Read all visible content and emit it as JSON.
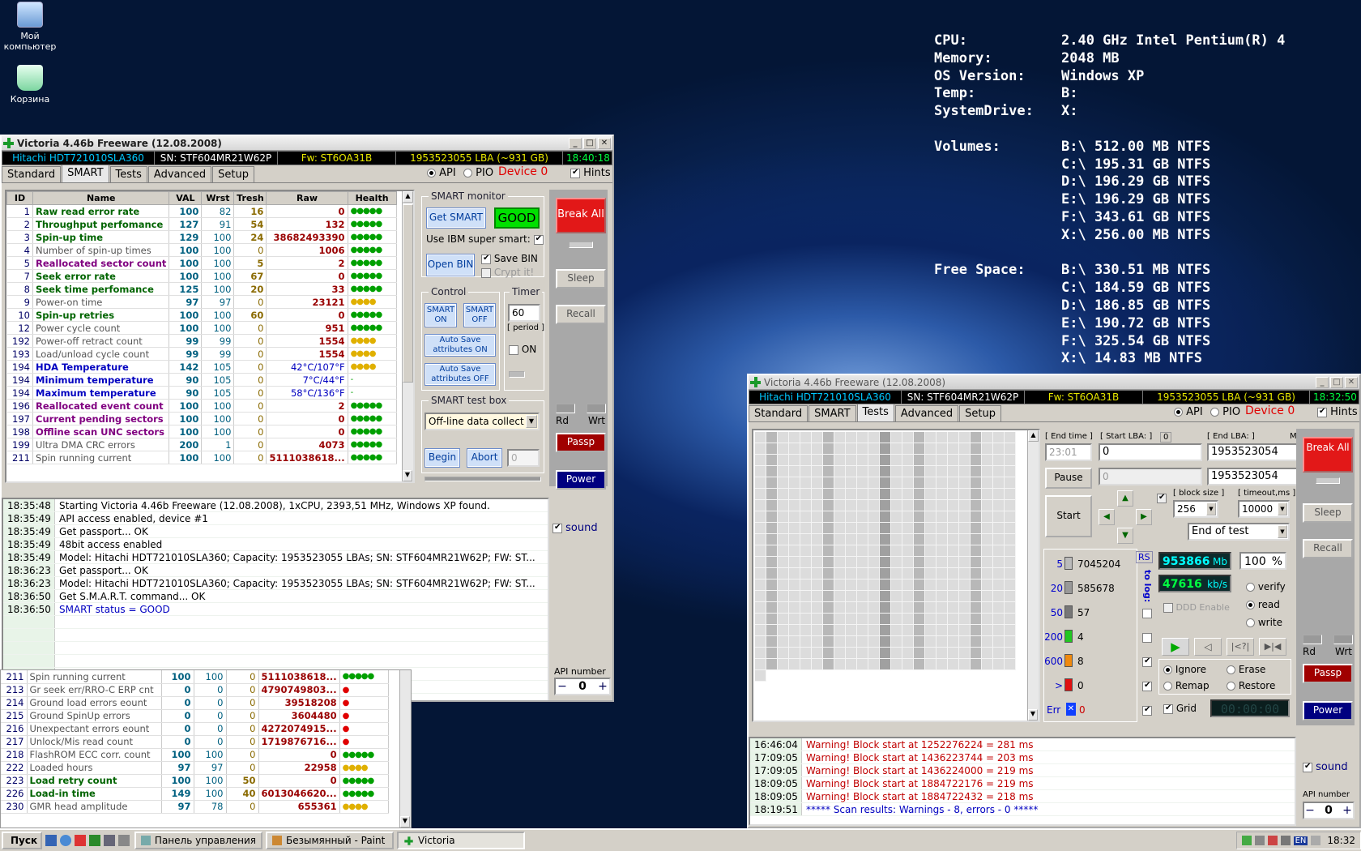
{
  "desktop": {
    "icons": [
      {
        "label": "Мой компьютер"
      },
      {
        "label": "Корзина"
      }
    ]
  },
  "bginfo": {
    "rows": [
      [
        "CPU:",
        "2.40 GHz Intel Pentium(R) 4"
      ],
      [
        "Memory:",
        "2048 MB"
      ],
      [
        "OS Version:",
        "Windows XP"
      ],
      [
        "Temp:",
        "B:"
      ],
      [
        "SystemDrive:",
        "X:"
      ]
    ],
    "volumes_label": "Volumes:",
    "volumes": [
      "B:\\ 512.00 MB NTFS",
      "C:\\ 195.31 GB NTFS",
      "D:\\ 196.29 GB NTFS",
      "E:\\ 196.29 GB NTFS",
      "F:\\ 343.61 GB NTFS",
      "X:\\ 256.00 MB NTFS"
    ],
    "free_label": "Free Space:",
    "free": [
      "B:\\ 330.51 MB NTFS",
      "C:\\ 184.59 GB NTFS",
      "D:\\ 186.85 GB NTFS",
      "E:\\ 190.72 GB NTFS",
      "F:\\ 325.54 GB NTFS",
      "X:\\ 14.83 MB NTFS"
    ]
  },
  "win1": {
    "title": "Victoria 4.46b Freeware (12.08.2008)",
    "model": "Hitachi HDT721010SLA360",
    "sn": "SN: STF604MR21W62P",
    "fw": "Fw: ST6OA31B",
    "lba": "1953523055 LBA (~931 GB)",
    "clock": "18:40:18",
    "tabs": [
      "Standard",
      "SMART",
      "Tests",
      "Advanced",
      "Setup"
    ],
    "api": "API",
    "pio": "PIO",
    "device": "Device 0",
    "hints": "Hints",
    "columns": [
      "ID",
      "Name",
      "VAL",
      "Wrst",
      "Tresh",
      "Raw",
      "Health"
    ],
    "rows": [
      [
        "1",
        "Raw read error rate",
        "100",
        "82",
        "16",
        "0",
        "●●●●●",
        "g"
      ],
      [
        "2",
        "Throughput perfomance",
        "127",
        "91",
        "54",
        "132",
        "●●●●●",
        "g"
      ],
      [
        "3",
        "Spin-up time",
        "129",
        "100",
        "24",
        "38682493390",
        "●●●●●",
        "g"
      ],
      [
        "4",
        "Number of spin-up times",
        "100",
        "100",
        "0",
        "1006",
        "●●●●●",
        "n"
      ],
      [
        "5",
        "Reallocated sector count",
        "100",
        "100",
        "5",
        "2",
        "●●●●●",
        "p"
      ],
      [
        "7",
        "Seek error rate",
        "100",
        "100",
        "67",
        "0",
        "●●●●●",
        "g"
      ],
      [
        "8",
        "Seek time perfomance",
        "125",
        "100",
        "20",
        "33",
        "●●●●●",
        "g"
      ],
      [
        "9",
        "Power-on time",
        "97",
        "97",
        "0",
        "23121",
        "●●●●",
        "n"
      ],
      [
        "10",
        "Spin-up retries",
        "100",
        "100",
        "60",
        "0",
        "●●●●●",
        "g"
      ],
      [
        "12",
        "Power cycle count",
        "100",
        "100",
        "0",
        "951",
        "●●●●●",
        "n"
      ],
      [
        "192",
        "Power-off retract count",
        "99",
        "99",
        "0",
        "1554",
        "●●●●",
        "n"
      ],
      [
        "193",
        "Load/unload cycle count",
        "99",
        "99",
        "0",
        "1554",
        "●●●●",
        "n"
      ],
      [
        "194",
        "HDA Temperature",
        "142",
        "105",
        "0",
        "42°C/107°F",
        "●●●●",
        "b"
      ],
      [
        "194",
        "Minimum temperature",
        "90",
        "105",
        "0",
        "7°C/44°F",
        "-",
        "b"
      ],
      [
        "194",
        "Maximum temperature",
        "90",
        "105",
        "0",
        "58°C/136°F",
        "-",
        "b"
      ],
      [
        "196",
        "Reallocated event count",
        "100",
        "100",
        "0",
        "2",
        "●●●●●",
        "p"
      ],
      [
        "197",
        "Current pending sectors",
        "100",
        "100",
        "0",
        "0",
        "●●●●●",
        "p"
      ],
      [
        "198",
        "Offline scan UNC sectors",
        "100",
        "100",
        "0",
        "0",
        "●●●●●",
        "p"
      ],
      [
        "199",
        "Ultra DMA CRC errors",
        "200",
        "1",
        "0",
        "4073",
        "●●●●●",
        "n"
      ],
      [
        "211",
        "Spin running current",
        "100",
        "100",
        "0",
        "5111038618...",
        "●●●●●",
        "n"
      ]
    ],
    "smart_monitor": "SMART monitor",
    "get_smart": "Get SMART",
    "status": "GOOD",
    "ibm": "Use IBM super smart:",
    "open_bin": "Open BIN",
    "save_bin": "Save BIN",
    "crypt": "Crypt it!",
    "control": "Control",
    "timer": "Timer",
    "smart_on": "SMART ON",
    "smart_off": "SMART OFF",
    "timer_val": "60",
    "period": "[ period ]",
    "auto_on": "Auto Save attributes ON",
    "auto_off": "Auto Save attributes OFF",
    "on": "ON",
    "testbox": "SMART test box",
    "test_sel": "Off-line data collect",
    "begin": "Begin",
    "abort": "Abort",
    "abort_val": "0",
    "break_all": "Break All",
    "sleep": "Sleep",
    "recall": "Recall",
    "rd": "Rd",
    "wrt": "Wrt",
    "passp": "Passp",
    "power": "Power",
    "sound": "sound",
    "api_number": "API number",
    "api_val": "0",
    "log": [
      [
        "18:35:48",
        "Starting Victoria 4.46b Freeware (12.08.2008), 1xCPU, 2393,51 MHz, Windows XP found."
      ],
      [
        "18:35:49",
        "API access enabled, device #1"
      ],
      [
        "18:35:49",
        "Get passport... OK"
      ],
      [
        "18:35:49",
        "48bit access enabled"
      ],
      [
        "18:35:49",
        "Model: Hitachi HDT721010SLA360; Capacity: 1953523055 LBAs; SN: STF604MR21W62P; FW: ST..."
      ],
      [
        "18:36:23",
        "Get passport... OK"
      ],
      [
        "18:36:23",
        "Model: Hitachi HDT721010SLA360; Capacity: 1953523055 LBAs; SN: STF604MR21W62P; FW: ST..."
      ],
      [
        "18:36:50",
        "Get S.M.A.R.T. command... OK"
      ],
      [
        "18:36:50",
        "SMART status = GOOD"
      ]
    ]
  },
  "extra_rows": [
    [
      "211",
      "Spin running current",
      "100",
      "100",
      "0",
      "5111038618...",
      "●●●●●",
      "n"
    ],
    [
      "213",
      "Gr seek err/RRO-C ERP cnt",
      "0",
      "0",
      "0",
      "4790749803...",
      "●",
      "n"
    ],
    [
      "214",
      "Ground load errors eount",
      "0",
      "0",
      "0",
      "39518208",
      "●",
      "n"
    ],
    [
      "215",
      "Ground SpinUp errors",
      "0",
      "0",
      "0",
      "3604480",
      "●",
      "n"
    ],
    [
      "216",
      "Unexpectant errors eount",
      "0",
      "0",
      "0",
      "4272074915...",
      "●",
      "n"
    ],
    [
      "217",
      "Unlock/Mis read count",
      "0",
      "0",
      "0",
      "1719876716...",
      "●",
      "n"
    ],
    [
      "218",
      "FlashROM ECC corr. count",
      "100",
      "100",
      "0",
      "0",
      "●●●●●",
      "n"
    ],
    [
      "222",
      "Loaded hours",
      "97",
      "97",
      "0",
      "22958",
      "●●●●",
      "n"
    ],
    [
      "223",
      "Load retry count",
      "100",
      "100",
      "50",
      "0",
      "●●●●●",
      "g"
    ],
    [
      "226",
      "Load-in time",
      "149",
      "100",
      "40",
      "6013046620...",
      "●●●●●",
      "g"
    ],
    [
      "230",
      "GMR head amplitude",
      "97",
      "78",
      "0",
      "655361",
      "●●●●",
      "n"
    ]
  ],
  "win2": {
    "title": "Victoria 4.46b Freeware (12.08.2008)",
    "model": "Hitachi HDT721010SLA360",
    "sn": "SN: STF604MR21W62P",
    "fw": "Fw: ST6OA31B",
    "lba": "1953523055 LBA (~931 GB)",
    "clock": "18:32:50",
    "tabs": [
      "Standard",
      "SMART",
      "Tests",
      "Advanced",
      "Setup"
    ],
    "api": "API",
    "pio": "PIO",
    "device": "Device 0",
    "hints": "Hints",
    "end_time_lbl": "[ End time ]",
    "end_time": "23:01",
    "start_lba_lbl": "[ Start LBA: ]",
    "start_lba_zero": "0",
    "end_lba_lbl": "[ End LBA: ]",
    "max": "MAX",
    "start_lba": "0",
    "end_lba": "1953523054",
    "cur_lba": "0",
    "cur_end": "1953523054",
    "pause": "Pause",
    "start": "Start",
    "block_lbl": "[ block size ]",
    "block": "256",
    "timeout_lbl": "[ timeout,ms ]",
    "timeout": "10000",
    "end_mode": "End of test",
    "rs": "RS",
    "tolog": "to log:",
    "counts": [
      [
        "5",
        "7045204",
        "#bbbbbb"
      ],
      [
        "20",
        "585678",
        "#999999"
      ],
      [
        "50",
        "57",
        "#777777"
      ],
      [
        "200",
        "4",
        "#22c722"
      ],
      [
        "600",
        "8",
        "#f08a10"
      ],
      [
        ">",
        "0",
        "#e01010"
      ]
    ],
    "err_label": "Err",
    "err_val": "0",
    "mb": "953866",
    "mb_unit": "Mb",
    "pct": "100",
    "pct_unit": "%",
    "speed": "47616",
    "speed_unit": "kb/s",
    "verify": "verify",
    "read": "read",
    "write": "write",
    "ddd": "DDD Enable",
    "ignore": "Ignore",
    "erase": "Erase",
    "remap": "Remap",
    "restore": "Restore",
    "grid": "Grid",
    "timer": "00:00:00",
    "break_all": "Break All",
    "sleep": "Sleep",
    "recall": "Recall",
    "rd": "Rd",
    "wrt": "Wrt",
    "passp": "Passp",
    "power": "Power",
    "sound": "sound",
    "api_number": "API number",
    "api_val": "0",
    "log": [
      [
        "16:46:04",
        "Warning! Block start at 1252276224 = 281 ms",
        "r"
      ],
      [
        "17:09:05",
        "Warning! Block start at 1436223744 = 203 ms",
        "r"
      ],
      [
        "17:09:05",
        "Warning! Block start at 1436224000 = 219 ms",
        "r"
      ],
      [
        "18:09:05",
        "Warning! Block start at 1884722176 = 219 ms",
        "r"
      ],
      [
        "18:09:05",
        "Warning! Block start at 1884722432 = 218 ms",
        "r"
      ],
      [
        "18:19:51",
        "***** Scan results: Warnings - 8, errors - 0 *****",
        "b"
      ]
    ]
  },
  "taskbar": {
    "start": "Пуск",
    "items": [
      "Панель управления",
      "Безымянный - Paint",
      "Victoria"
    ],
    "lang": "EN",
    "clock": "18:32"
  }
}
